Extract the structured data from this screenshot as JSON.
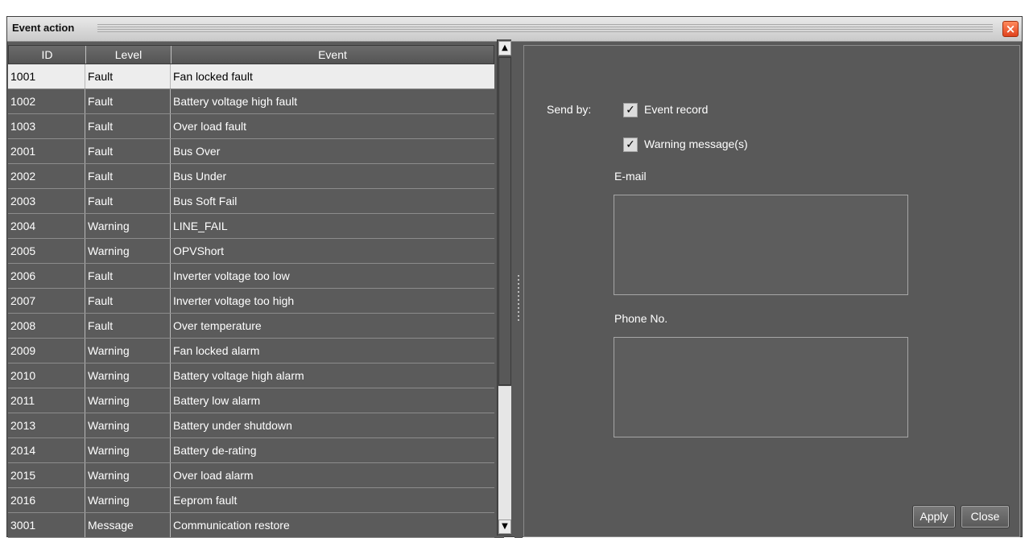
{
  "window": {
    "title": "Event action",
    "close_glyph": "×"
  },
  "table": {
    "headers": [
      "ID",
      "Level",
      "Event"
    ],
    "rows": [
      {
        "id": "1001",
        "level": "Fault",
        "event": "Fan locked fault"
      },
      {
        "id": "1002",
        "level": "Fault",
        "event": "Battery voltage high fault"
      },
      {
        "id": "1003",
        "level": "Fault",
        "event": "Over load fault"
      },
      {
        "id": "2001",
        "level": "Fault",
        "event": "Bus Over"
      },
      {
        "id": "2002",
        "level": "Fault",
        "event": "Bus Under"
      },
      {
        "id": "2003",
        "level": "Fault",
        "event": "Bus Soft Fail"
      },
      {
        "id": "2004",
        "level": "Warning",
        "event": "LINE_FAIL"
      },
      {
        "id": "2005",
        "level": "Warning",
        "event": "OPVShort"
      },
      {
        "id": "2006",
        "level": "Fault",
        "event": "Inverter voltage too low"
      },
      {
        "id": "2007",
        "level": "Fault",
        "event": "Inverter voltage too high"
      },
      {
        "id": "2008",
        "level": "Fault",
        "event": "Over temperature"
      },
      {
        "id": "2009",
        "level": "Warning",
        "event": "Fan locked alarm"
      },
      {
        "id": "2010",
        "level": "Warning",
        "event": "Battery voltage high alarm"
      },
      {
        "id": "2011",
        "level": "Warning",
        "event": "Battery low alarm"
      },
      {
        "id": "2013",
        "level": "Warning",
        "event": "Battery under shutdown"
      },
      {
        "id": "2014",
        "level": "Warning",
        "event": "Battery de-rating"
      },
      {
        "id": "2015",
        "level": "Warning",
        "event": "Over load alarm"
      },
      {
        "id": "2016",
        "level": "Warning",
        "event": "Eeprom fault"
      },
      {
        "id": "3001",
        "level": "Message",
        "event": "Communication restore"
      }
    ],
    "selected_row": 0
  },
  "panel": {
    "send_by_label": "Send by:",
    "event_record_label": "Event record",
    "event_record_checked": true,
    "warning_messages_label": "Warning message(s)",
    "warning_messages_checked": true,
    "email_label": "E-mail",
    "email_value": "",
    "phone_label": "Phone No.",
    "phone_value": "",
    "apply_label": "Apply",
    "close_label": "Close"
  },
  "icons": {
    "check_glyph": "✓",
    "scroll_up_glyph": "▲",
    "scroll_down_glyph": "▼"
  },
  "colors": {
    "window_bg": "#595959",
    "selected_row_bg": "#ededed",
    "close_button": "#e0431e"
  }
}
